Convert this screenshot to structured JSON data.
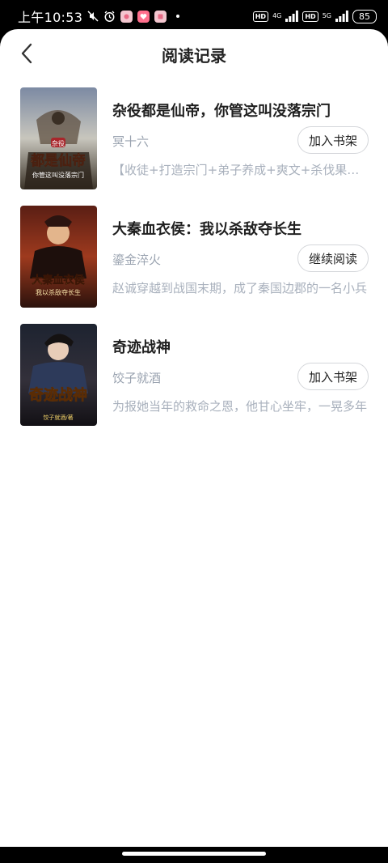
{
  "status_bar": {
    "time": "上午10:53",
    "hd1": "HD",
    "signal1": "4G",
    "hd2": "HD",
    "signal2": "5G",
    "battery": "85"
  },
  "header": {
    "title": "阅读记录"
  },
  "books": [
    {
      "title": "杂役都是仙帝，你管这叫没落宗门",
      "author": "冥十六",
      "button": "加入书架",
      "desc": "【收徒+打造宗门+弟子养成+爽文+杀伐果断】",
      "cover_text": "都是仙帝",
      "cover_tag": "杂役",
      "cover_sub": "你管这叫没落宗门"
    },
    {
      "title": "大秦血衣侯：我以杀敌夺长生",
      "author": "鎏金淬火",
      "button": "继续阅读",
      "desc": "赵诚穿越到战国末期，成了秦国边郡的一名小兵",
      "cover_text": "大秦血衣侯",
      "cover_sub": "我以杀敌夺长生"
    },
    {
      "title": "奇迹战神",
      "author": "饺子就酒",
      "button": "加入书架",
      "desc": "为报她当年的救命之恩，他甘心坐牢，一晃多年",
      "cover_text": "奇迹战神",
      "cover_sub": "饺子就酒/著"
    }
  ],
  "colors": {
    "title": "#1f1f1f",
    "author": "#9aa3b0",
    "desc": "#a8b0bc",
    "button_border": "#d4d6da"
  }
}
